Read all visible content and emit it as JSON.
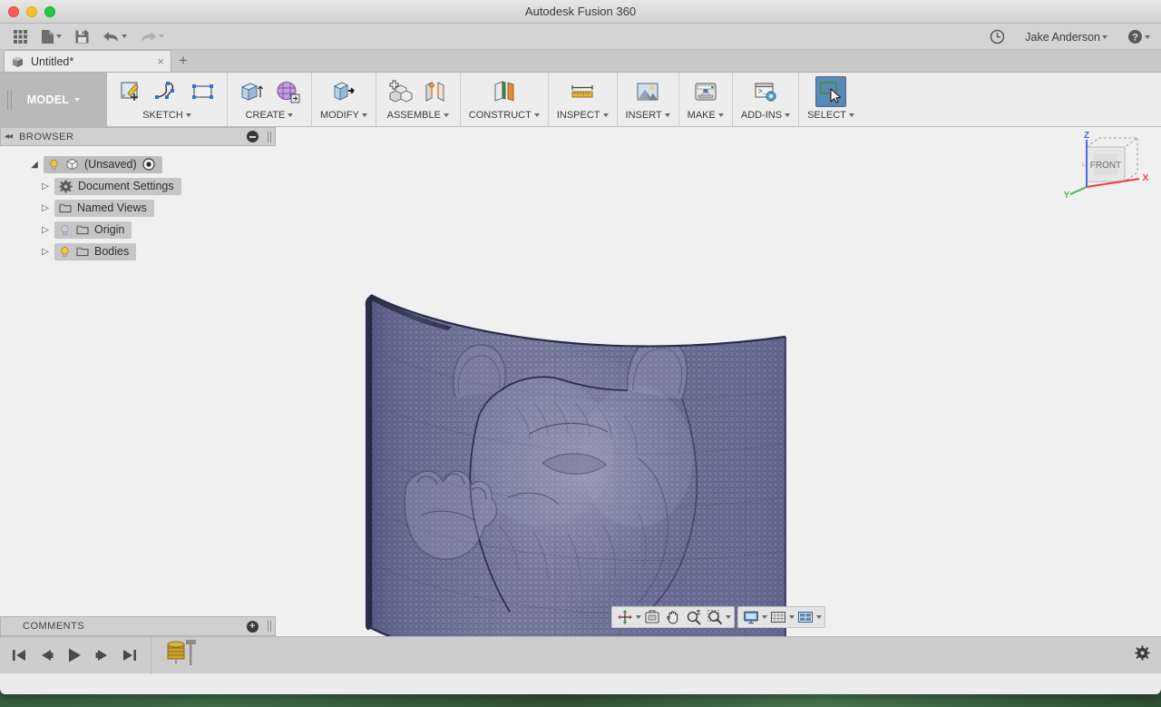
{
  "window": {
    "title": "Autodesk Fusion 360",
    "traffic_lights": [
      "close",
      "minimize",
      "maximize"
    ]
  },
  "quick_access": {
    "app_grid": "app-grid",
    "file": "New / Open File",
    "save": "Save",
    "undo": "Undo",
    "redo": "Redo",
    "recent": "Recent / Job Status",
    "username": "Jake Anderson",
    "help": "Help"
  },
  "tabs": {
    "items": [
      {
        "label": "Untitled*",
        "close": "×",
        "active": true
      }
    ],
    "add_label": "+"
  },
  "ribbon": {
    "workspace": {
      "label": "MODEL"
    },
    "panels": [
      {
        "label": "SKETCH",
        "name": "sketch",
        "icons": [
          "create-sketch-icon",
          "spline-icon",
          "rectangle-icon"
        ]
      },
      {
        "label": "CREATE",
        "name": "create",
        "icons": [
          "extrude-icon",
          "create-form-icon"
        ]
      },
      {
        "label": "MODIFY",
        "name": "modify",
        "icons": [
          "press-pull-icon"
        ]
      },
      {
        "label": "ASSEMBLE",
        "name": "assemble",
        "icons": [
          "new-component-icon",
          "joint-icon"
        ]
      },
      {
        "label": "CONSTRUCT",
        "name": "construct",
        "icons": [
          "offset-plane-icon"
        ]
      },
      {
        "label": "INSPECT",
        "name": "inspect",
        "icons": [
          "measure-icon"
        ]
      },
      {
        "label": "INSERT",
        "name": "insert",
        "icons": [
          "insert-image-icon"
        ]
      },
      {
        "label": "MAKE",
        "name": "make",
        "icons": [
          "3d-print-icon"
        ]
      },
      {
        "label": "ADD-INS",
        "name": "addins",
        "icons": [
          "scripts-addins-icon"
        ]
      },
      {
        "label": "SELECT",
        "name": "select",
        "icons": [
          "select-window-icon"
        ],
        "active": true
      }
    ]
  },
  "browser": {
    "header": "BROWSER",
    "collapse_glyph": "◂◂",
    "tree": [
      {
        "label": "(Unsaved)",
        "indent": 0,
        "twisty": "◢",
        "bulb": "on",
        "icon": "component-icon",
        "trailing": "target-icon"
      },
      {
        "label": "Document Settings",
        "indent": 1,
        "twisty": "▷",
        "bulb": "none",
        "icon": "gear-icon"
      },
      {
        "label": "Named Views",
        "indent": 1,
        "twisty": "▷",
        "bulb": "none",
        "icon": "folder-icon"
      },
      {
        "label": "Origin",
        "indent": 1,
        "twisty": "▷",
        "bulb": "off",
        "icon": "folder-icon"
      },
      {
        "label": "Bodies",
        "indent": 1,
        "twisty": "▷",
        "bulb": "on",
        "icon": "folder-icon"
      }
    ]
  },
  "comments": {
    "header": "COMMENTS",
    "add_glyph": "+"
  },
  "canvas": {
    "background_color": "#f0f0f0",
    "model": {
      "name": "curved-relief-mesh",
      "description": "Curved triangulated mesh surface with embossed bear head relief",
      "mesh_color": "#7b7fa8",
      "edge_color": "#2f3050"
    },
    "viewcube": {
      "face_label": "FRONT",
      "axes": [
        {
          "label": "X",
          "color": "#e8423a"
        },
        {
          "label": "Y",
          "color": "#55b055"
        },
        {
          "label": "Z",
          "color": "#4a66e0"
        }
      ]
    }
  },
  "navigation_bar": {
    "groups": [
      {
        "name": "view-tools",
        "buttons": [
          {
            "name": "orbit-icon",
            "label": "Orbit",
            "caret": true
          },
          {
            "name": "look-at-icon",
            "label": "Look At",
            "caret": false
          },
          {
            "name": "pan-icon",
            "label": "Pan",
            "caret": false
          },
          {
            "name": "zoom-icon",
            "label": "Zoom",
            "caret": false
          },
          {
            "name": "zoom-window-icon",
            "label": "Zoom Window",
            "caret": true
          }
        ]
      },
      {
        "name": "display-tools",
        "buttons": [
          {
            "name": "display-settings-icon",
            "label": "Display Settings",
            "caret": true
          },
          {
            "name": "grid-snaps-icon",
            "label": "Grid and Snaps",
            "caret": true
          },
          {
            "name": "viewports-icon",
            "label": "Viewports",
            "caret": true
          }
        ]
      }
    ]
  },
  "timeline": {
    "playback": [
      {
        "name": "go-to-beginning-button",
        "glyph": "skip-back"
      },
      {
        "name": "step-back-button",
        "glyph": "step-back"
      },
      {
        "name": "play-button",
        "glyph": "play"
      },
      {
        "name": "step-forward-button",
        "glyph": "step-forward"
      },
      {
        "name": "go-to-end-button",
        "glyph": "skip-forward"
      }
    ],
    "marker": {
      "name": "timeline-end-marker",
      "color": "#c8a52e"
    },
    "settings": "timeline-settings-gear"
  }
}
